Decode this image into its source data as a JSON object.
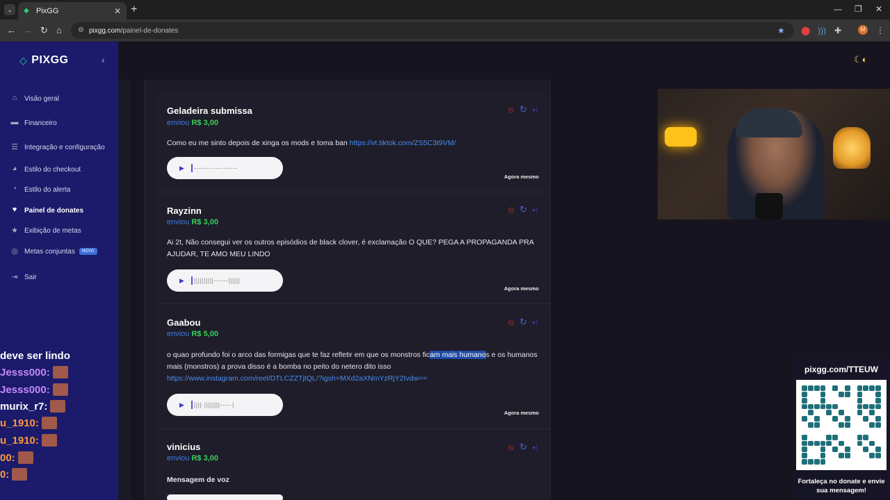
{
  "browser": {
    "tab_title": "PixGG",
    "url_domain": "pixgg.com",
    "url_path": "/painel-de-donates",
    "profile_initial": "M"
  },
  "sidebar": {
    "logo": "PIXGG",
    "items": [
      {
        "label": "Visão geral",
        "icon": "home-icon"
      },
      {
        "label": "Financeiro",
        "icon": "wallet-icon"
      },
      {
        "label": "Integração e configuração",
        "icon": "settings-icon"
      },
      {
        "label": "Estilo do checkout",
        "icon": "palette-icon"
      },
      {
        "label": "Estilo do alerta",
        "icon": "alert-icon"
      },
      {
        "label": "Painel de donates",
        "icon": "donate-icon"
      },
      {
        "label": "Exibição de metas",
        "icon": "star-icon"
      },
      {
        "label": "Metas conjuntas",
        "icon": "target-icon",
        "badge": "NOVO"
      },
      {
        "label": "Sair",
        "icon": "logout-icon"
      }
    ]
  },
  "chat": [
    {
      "text": "deve ser lindo",
      "color": "#ffffff"
    },
    {
      "text": "Jesss000:",
      "color": "#c58af9"
    },
    {
      "text": "Jesss000:",
      "color": "#c58af9"
    },
    {
      "text": "murix_r7:",
      "color": "#ffffff"
    },
    {
      "text": "u_1910:",
      "color": "#ff9a3c"
    },
    {
      "text": "u_1910:",
      "color": "#ff9a3c"
    },
    {
      "text": "00:",
      "color": "#ff9a3c"
    },
    {
      "text": "0:",
      "color": "#ff9a3c"
    }
  ],
  "donates": [
    {
      "name": "Geladeira submissa",
      "sent_label": "enviou",
      "amount": "R$ 3,00",
      "message": "Como eu me sinto depois de xinga os mods e toma ban ",
      "link": "https://vt.tiktok.com/ZS5C3t9VM/",
      "waveform": "-------·---·------",
      "time": "Agora mesmo"
    },
    {
      "name": "Rayzinn",
      "sent_label": "enviou",
      "amount": "R$ 3,00",
      "message": "Ai 2t, Não consegui ver os outros episódios de black clover, é exclamação O QUE? PEGA A PROPAGANDA PRA AJUDAR, TE AMO MEU LINDO",
      "link": "",
      "waveform": "||||||||||------||||||",
      "time": "Agora mesmo"
    },
    {
      "name": "Gaabou",
      "sent_label": "enviou",
      "amount": "R$ 5,00",
      "message_before": "o quao profundo foi o arco das formigas que te faz refletir em que os monstros fic",
      "message_highlight": "am mais humano",
      "message_after": "s e os humanos mais (monstros) a prova disso é a bomba no peito do netero dito isso",
      "link": "https://www.instagram.com/reel/DTLCZZTjtQL/?igsh=MXd2aXNmYzRjY2tvdw==",
      "waveform": "||||·||||||||----·|",
      "time": "Agora mesmo"
    },
    {
      "name": "vinicius",
      "sent_label": "enviou",
      "amount": "R$ 3,00",
      "message": "Mensagem de voz"
    }
  ],
  "qr": {
    "url": "pixgg.com/TTEUW",
    "caption": "Fortaleça no donate e envie sua mensagem!"
  },
  "colors": {
    "sidebar": "#1b1a6b",
    "accent_green": "#3ccf5a",
    "accent_blue": "#3d7de0",
    "ban_red": "#d9342b"
  }
}
